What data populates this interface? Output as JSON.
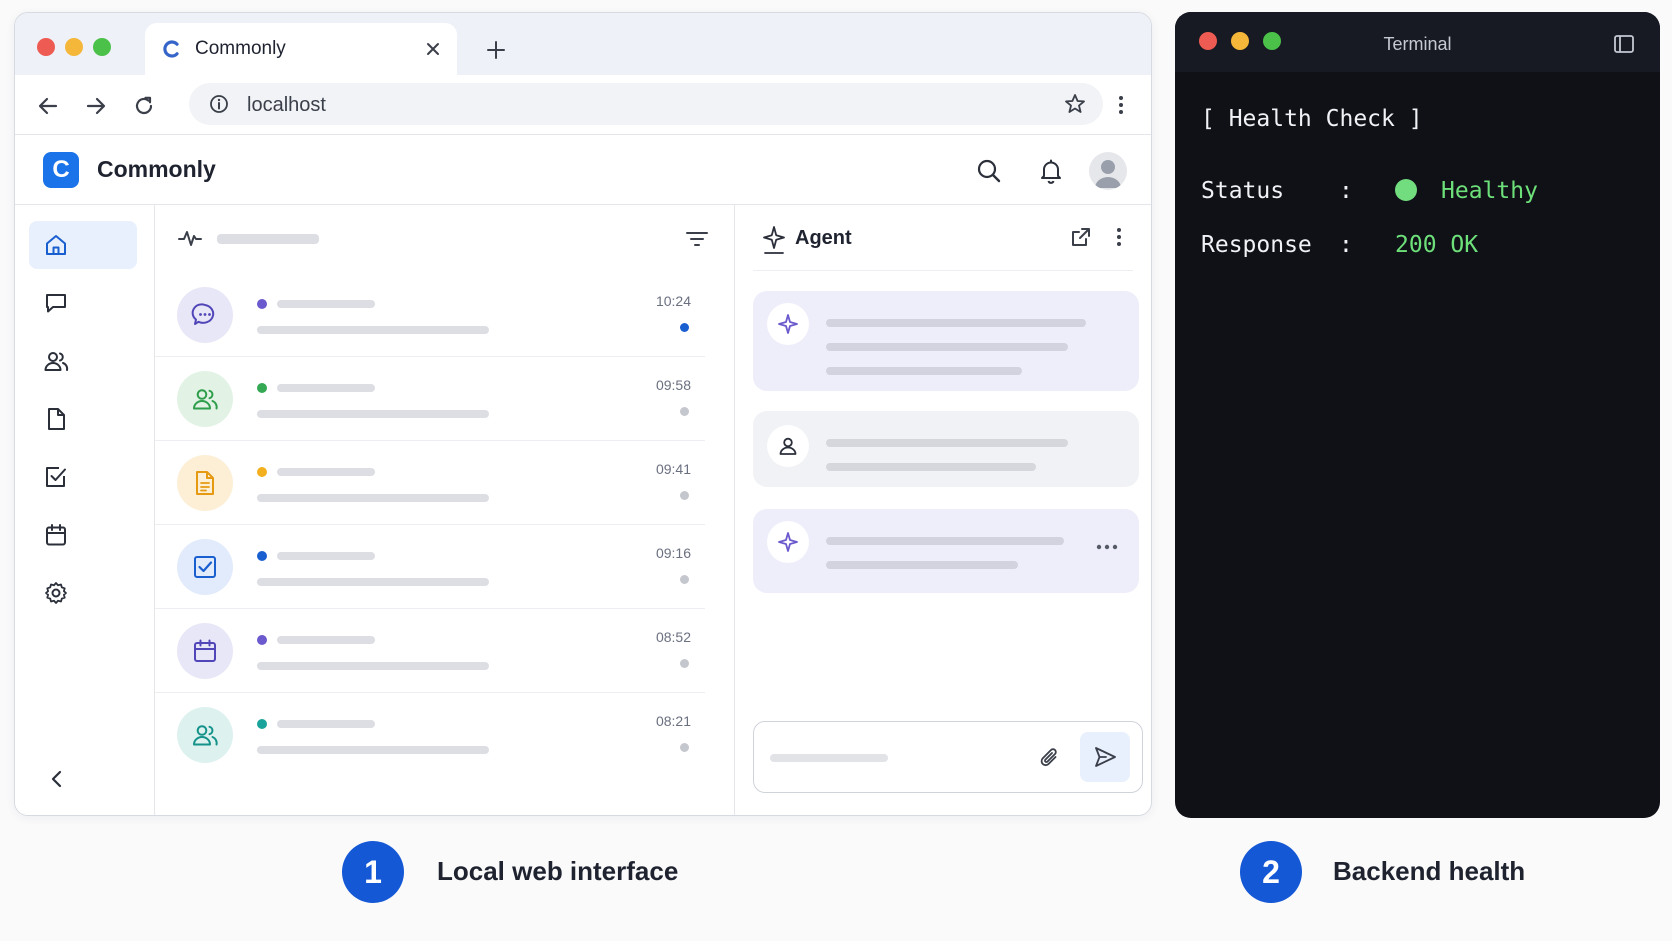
{
  "browser": {
    "tab_title": "Commonly",
    "url": "localhost"
  },
  "app": {
    "logo_letter": "C",
    "name": "Commonly",
    "accent": "#1a73e8"
  },
  "sidebar": {
    "items": [
      {
        "icon": "home-icon",
        "active": true
      },
      {
        "icon": "chat-icon"
      },
      {
        "icon": "users-icon"
      },
      {
        "icon": "document-icon"
      },
      {
        "icon": "checkbox-icon"
      },
      {
        "icon": "calendar-icon"
      },
      {
        "icon": "gear-icon"
      }
    ]
  },
  "feed": {
    "rows": [
      {
        "icon": "chat-bubble-icon",
        "time": "10:24",
        "dot_color": "#6a5acd",
        "unread": true
      },
      {
        "icon": "users-icon",
        "time": "09:58",
        "dot_color": "#34a853",
        "unread": false
      },
      {
        "icon": "document-icon",
        "time": "09:41",
        "dot_color": "#f2b01e",
        "unread": false
      },
      {
        "icon": "checkbox-icon",
        "time": "09:16",
        "dot_color": "#1a5fd0",
        "unread": false
      },
      {
        "icon": "calendar-icon",
        "time": "08:52",
        "dot_color": "#6a5acd",
        "unread": false
      },
      {
        "icon": "users-icon",
        "time": "08:21",
        "dot_color": "#1aa39a",
        "unread": false
      }
    ]
  },
  "agent": {
    "title": "Agent"
  },
  "terminal": {
    "title": "Terminal",
    "heading": "[ Health Check ]",
    "status_label": "Status",
    "status_sep": ":",
    "status_value": "Healthy",
    "response_label": "Response",
    "response_sep": ":",
    "response_value": "200 OK",
    "value_color": "#6ee07a"
  },
  "captions": [
    {
      "number": "1",
      "label": "Local web interface"
    },
    {
      "number": "2",
      "label": "Backend health"
    }
  ]
}
